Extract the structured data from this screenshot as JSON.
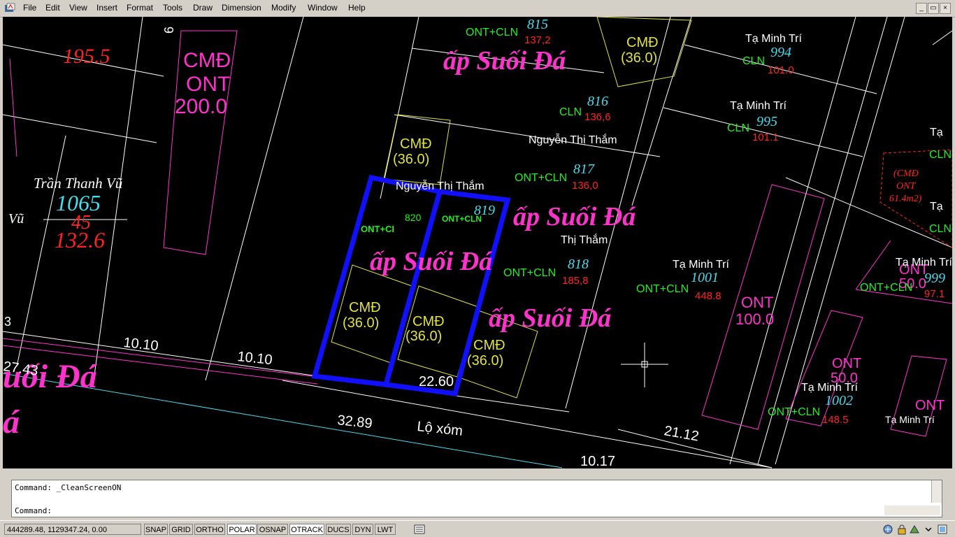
{
  "menu": {
    "items": [
      "File",
      "Edit",
      "View",
      "Insert",
      "Format",
      "Tools",
      "Draw",
      "Dimension",
      "Modify",
      "Window",
      "Help"
    ]
  },
  "window_controls": {
    "minimize": "_",
    "restore": "▭",
    "close": "×"
  },
  "drawing": {
    "labels": {
      "road": "Lộ xóm",
      "suoi_da_top": "ấp Suối Đá",
      "suoi_da_mid": "ấp Suối Đá",
      "suoi_da_mid2": "ấp Suối Đá",
      "suoi_da_low": "ấp Suối Đá",
      "suoi_da_left": "uối Đá",
      "suoi_da_left2": "á",
      "cmd_ont_a": "CMĐ",
      "cmd_ont_b": "ONT",
      "cmd_ont_c": "200.0",
      "tran_thanh_vu": "Trần Thanh Vũ",
      "vu": "Vũ",
      "p1065": "1065",
      "p1065_sheet": "45",
      "p1065_area": "132.6",
      "p195": "195.5",
      "cmd36_a": "CMĐ",
      "cmd36_b": "(36.0)",
      "cmd36_2a": "CMĐ",
      "cmd36_2b": "(36.0)",
      "cmd36_3a": "CMĐ",
      "cmd36_3b": "(36.0)",
      "cmd36_4a": "CMĐ",
      "cmd36_4b": "(36.0)",
      "cmd36_5a": "CMĐ",
      "cmd36_5b": "(36.0)",
      "ont_cln_815": "ONT+CLN",
      "p815": "815",
      "p815_area": "137,2",
      "cln_816": "CLN",
      "p816": "816",
      "p816_area": "136,6",
      "nguyen_thi_tham_1": "Nguyễn Thị Thắm",
      "ont_cln_817": "ONT+CLN",
      "p817": "817",
      "p817_area": "136,0",
      "nguyen_thi_tham_2": "Nguyễn Thị Thắm",
      "ont_ci": "ONT+CI",
      "p820": "820",
      "ont_cln_819": "ONT+CLN",
      "p819": "819",
      "thi_tham": "Thị Thắm",
      "ont_cln_818": "ONT+CLN",
      "p818": "818",
      "p818_area": "185,8",
      "ta_minh_tri_994": "Tạ Minh Trí",
      "cln_994": "CLN",
      "p994": "994",
      "p994_area": "101.0",
      "ta_minh_tri_995": "Tạ Minh Trí",
      "cln_995": "CLN",
      "p995": "995",
      "p995_area": "101.1",
      "ta_minh_tri_1001": "Tạ Minh Trí",
      "ont_cln_1001": "ONT+CLN",
      "p1001": "1001",
      "p1001_area": "448.8",
      "ont100_a": "ONT",
      "ont100_b": "100.0",
      "ta_minh_tri_1002": "Tạ Minh Trí",
      "ont_cln_1002": "ONT+CLN",
      "p1002": "1002",
      "p1002_area": "148.5",
      "ont50_a": "ONT",
      "ont50_b": "50.0",
      "ta_minh_tri_999": "Tạ Minh Trí",
      "ont_cln_999": "ONT+CLN",
      "p999": "999",
      "p999_area": "97.1",
      "ont50_2a": "ONT",
      "ont50_2b": "50.0",
      "ont_far": "ONT",
      "ta_minh_tri_far": "Tạ Minh Trí",
      "ta_edge_1": "Tạ",
      "cln_edge_1": "CLN",
      "ta_edge_2": "Tạ",
      "cln_edge_2": "CLN",
      "cmd_ont_note_a": "(CMĐ",
      "cmd_ont_note_b": "ONT",
      "cmd_ont_note_c": "61.4m2)",
      "dim_1010_a": "10.10",
      "dim_1010_b": "10.10",
      "dim_2743": "27.43",
      "dim_2260": "22.60",
      "dim_3289": "32.89",
      "dim_2112": "21.12",
      "dim_1017": "10.17",
      "dim_3": "3",
      "dim_6": "6"
    }
  },
  "command": {
    "history": "Command:  _CleanScreenON",
    "prompt": "Command:"
  },
  "status": {
    "coords": "444289.48, 1129347.24, 0.00",
    "buttons": [
      {
        "label": "SNAP",
        "on": false
      },
      {
        "label": "GRID",
        "on": false
      },
      {
        "label": "ORTHO",
        "on": false
      },
      {
        "label": "POLAR",
        "on": true
      },
      {
        "label": "OSNAP",
        "on": false
      },
      {
        "label": "OTRACK",
        "on": true
      },
      {
        "label": "DUCS",
        "on": false
      },
      {
        "label": "DYN",
        "on": false
      },
      {
        "label": "LWT",
        "on": false
      }
    ]
  },
  "colors": {
    "magenta": "#ff33cc",
    "green": "#22ee22",
    "red": "#ff2222",
    "cyan": "#44ddee",
    "yellow": "#e0e040",
    "white": "#ffffff",
    "blue": "#1010ff"
  }
}
